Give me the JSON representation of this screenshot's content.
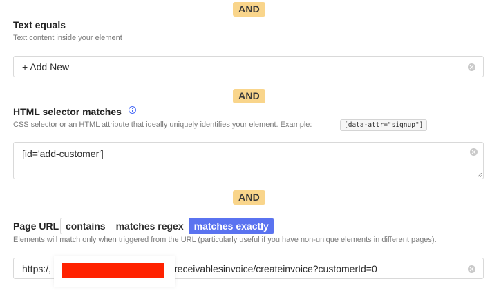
{
  "conditions": {
    "and_1": "AND",
    "and_2": "AND",
    "and_3": "AND"
  },
  "text_equals": {
    "label": "Text equals",
    "hint": "Text content inside your element",
    "value": "+ Add New"
  },
  "html_selector": {
    "label": "HTML selector matches",
    "hint": "CSS selector or an HTML attribute that ideally uniquely identifies your element. Example:",
    "example": "[data-attr=\"signup\"]",
    "value": "[id='add-customer']"
  },
  "page_url": {
    "label": "Page URL",
    "modes": [
      "contains",
      "matches regex",
      "matches exactly"
    ],
    "active_mode": "matches exactly",
    "hint": "Elements will match only when triggered from the URL (particularly useful if you have non-unique elements in different pages).",
    "value_prefix": "https:/,",
    "value_suffix": "receivablesinvoice/createinvoice?customerId=0"
  },
  "colors": {
    "and_badge": "#f9d58b",
    "active_segment": "#5a73f0",
    "redaction": "#ff2200",
    "info_icon": "#4a6cf7"
  },
  "icons": [
    "info-icon",
    "clear-icon"
  ]
}
